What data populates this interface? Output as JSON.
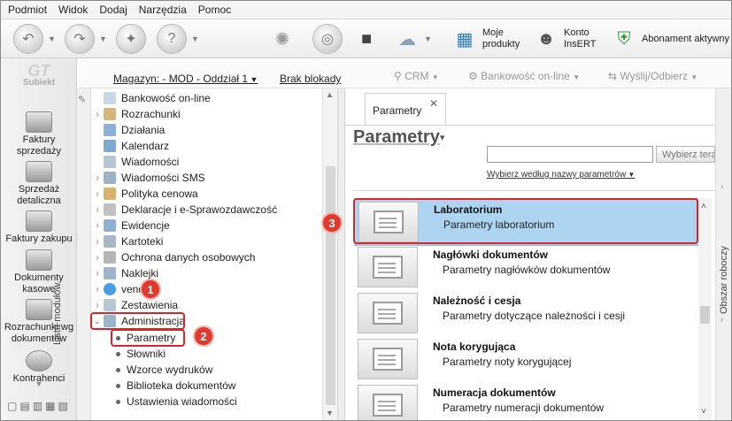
{
  "menu": [
    "Podmiot",
    "Widok",
    "Dodaj",
    "Narzędzia",
    "Pomoc"
  ],
  "toolbar": {
    "moje_produkty": "Moje\nprodukty",
    "konto": "Konto\nInsERT",
    "abonament": "Abonament aktywny"
  },
  "subbar": {
    "magazyn": "Magazyn: - MOD - Oddział 1",
    "brak_blokady": "Brak blokady",
    "crm": "CRM",
    "bankowosc": "Bankowość on-line",
    "wyslij": "Wyślij/Odbierz"
  },
  "logo": "Subiekt",
  "left_nav": [
    {
      "label": "Faktury sprzedaży"
    },
    {
      "label": "Sprzedaż detaliczna"
    },
    {
      "label": "Faktury zakupu"
    },
    {
      "label": "Dokumenty kasowe"
    },
    {
      "label": "Rozrachunki wg dokumentów"
    },
    {
      "label": "Kontrahenci"
    }
  ],
  "modules_strip": "Lista modułów",
  "tree": [
    {
      "label": "Bankowość on-line"
    },
    {
      "label": "Rozrachunki"
    },
    {
      "label": "Działania"
    },
    {
      "label": "Kalendarz"
    },
    {
      "label": "Wiadomości"
    },
    {
      "label": "Wiadomości SMS"
    },
    {
      "label": "Polityka cenowa"
    },
    {
      "label": "Deklaracje i e-Sprawozdawczość"
    },
    {
      "label": "Ewidencje"
    },
    {
      "label": "Kartoteki"
    },
    {
      "label": "Ochrona danych osobowych"
    },
    {
      "label": "Naklejki"
    },
    {
      "label": "vendero"
    },
    {
      "label": "Zestawienia"
    },
    {
      "label": "Administracja"
    },
    {
      "label": "Parametry"
    },
    {
      "label": "Słowniki"
    },
    {
      "label": "Wzorce wydruków"
    },
    {
      "label": "Biblioteka dokumentów"
    },
    {
      "label": "Ustawienia wiadomości"
    }
  ],
  "panel": {
    "tab": "Parametry",
    "title": "Parametry",
    "search_button": "Wybierz tera",
    "filter": "Wybierz według nazwy parametrów",
    "items": [
      {
        "title": "Laboratorium",
        "sub": "Parametry laboratorium"
      },
      {
        "title": "Nagłówki dokumentów",
        "sub": "Parametry nagłówków dokumentów"
      },
      {
        "title": "Należność i cesja",
        "sub": "Parametry dotyczące należności i cesji"
      },
      {
        "title": "Nota korygująca",
        "sub": "Parametry noty korygującej"
      },
      {
        "title": "Numeracja dokumentów",
        "sub": "Parametry numeracji dokumentów"
      }
    ]
  },
  "right_strip": "Obszar roboczy",
  "badges": [
    "1",
    "2",
    "3"
  ]
}
